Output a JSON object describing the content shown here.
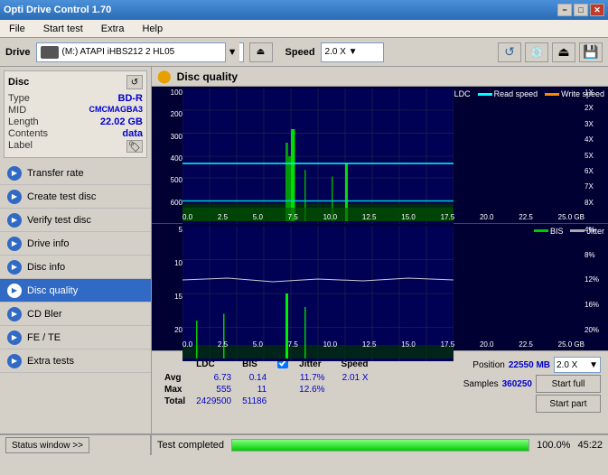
{
  "titleBar": {
    "title": "Opti Drive Control 1.70",
    "minimize": "−",
    "maximize": "□",
    "close": "✕"
  },
  "menuBar": {
    "items": [
      "File",
      "Start test",
      "Extra",
      "Help"
    ]
  },
  "driveBar": {
    "driveLabel": "Drive",
    "driveValue": "(M:)  ATAPI iHBS212  2 HL05",
    "speedLabel": "Speed",
    "speedValue": "2.0 X ▼"
  },
  "disc": {
    "title": "Disc",
    "type_label": "Type",
    "type_value": "BD-R",
    "mid_label": "MID",
    "mid_value": "CMCMAGBA3",
    "length_label": "Length",
    "length_value": "22.02 GB",
    "contents_label": "Contents",
    "contents_value": "data",
    "label_label": "Label"
  },
  "sidebar": {
    "items": [
      {
        "id": "transfer-rate",
        "label": "Transfer rate"
      },
      {
        "id": "create-test-disc",
        "label": "Create test disc"
      },
      {
        "id": "verify-test-disc",
        "label": "Verify test disc"
      },
      {
        "id": "drive-info",
        "label": "Drive info"
      },
      {
        "id": "disc-info",
        "label": "Disc info"
      },
      {
        "id": "disc-quality",
        "label": "Disc quality",
        "active": true
      },
      {
        "id": "cd-bler",
        "label": "CD Bler"
      },
      {
        "id": "fe-te",
        "label": "FE / TE"
      },
      {
        "id": "extra-tests",
        "label": "Extra tests"
      }
    ]
  },
  "content": {
    "title": "Disc quality"
  },
  "chart": {
    "legend_top": [
      {
        "label": "LDC",
        "color": "#00cc00"
      },
      {
        "label": "Read speed",
        "color": "#00ffff"
      },
      {
        "label": "Write speed",
        "color": "#ff8800"
      }
    ],
    "legend_bottom": [
      {
        "label": "BIS",
        "color": "#00cc00"
      },
      {
        "label": "Jitter",
        "color": "#cccccc"
      }
    ],
    "yAxisTop": [
      "100",
      "200",
      "300",
      "400",
      "500",
      "600"
    ],
    "yAxisTopRight": [
      "1X",
      "2X",
      "3X",
      "4X",
      "5X",
      "6X",
      "7X",
      "8X"
    ],
    "yAxisBottom": [
      "5",
      "10",
      "15",
      "20"
    ],
    "yAxisBottomRight": [
      "4%",
      "8%",
      "12%",
      "16%",
      "20%"
    ],
    "xAxis": [
      "0.0",
      "2.5",
      "5.0",
      "7.5",
      "10.0",
      "12.5",
      "15.0",
      "17.5",
      "20.0",
      "22.5",
      "25.0 GB"
    ]
  },
  "stats": {
    "headers": [
      "LDC",
      "BIS",
      "",
      "Jitter",
      "Speed"
    ],
    "avg_label": "Avg",
    "avg_ldc": "6.73",
    "avg_bis": "0.14",
    "avg_jitter": "11.7%",
    "avg_speed": "2.01 X",
    "max_label": "Max",
    "max_ldc": "555",
    "max_bis": "11",
    "max_jitter": "12.6%",
    "total_label": "Total",
    "total_ldc": "2429500",
    "total_bis": "51186",
    "position_label": "Position",
    "position_value": "22550 MB",
    "samples_label": "Samples",
    "samples_value": "360250",
    "speed_select": "2.0 X",
    "start_full": "Start full",
    "start_part": "Start part",
    "jitter_label": "Jitter"
  },
  "statusBar": {
    "leftLabel": "Status window >>",
    "rightLabel": "Test completed",
    "progress": "100.0%",
    "time": "45:22"
  }
}
